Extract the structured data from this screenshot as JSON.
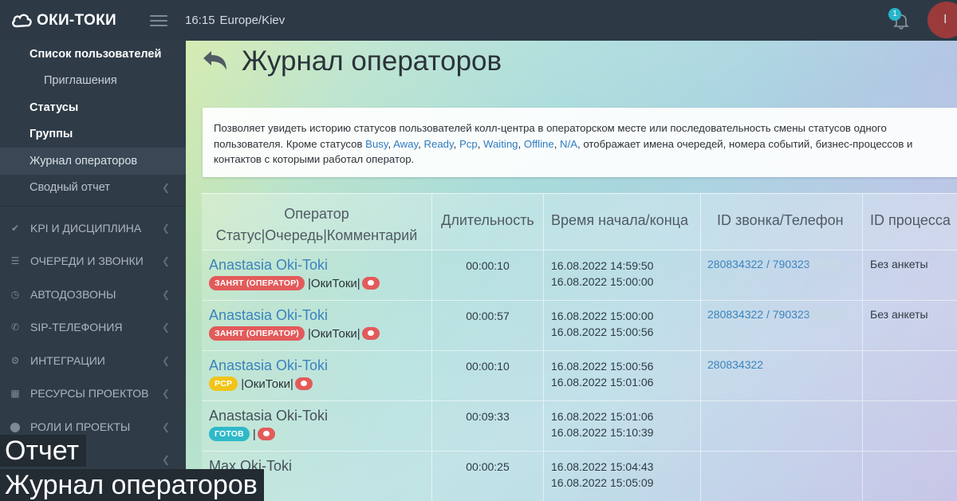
{
  "app": {
    "logo_text": "ОКИ-ТОКИ",
    "time": "16:15",
    "timezone": "Europe/Kiev",
    "notifications": "1",
    "avatar_letter": "I"
  },
  "sidebar": {
    "items": [
      {
        "label": "Список пользователей"
      },
      {
        "label": "Приглашения"
      },
      {
        "label": "Статусы"
      },
      {
        "label": "Группы"
      },
      {
        "label": "Журнал операторов"
      },
      {
        "label": "Сводный отчет"
      }
    ],
    "groups": [
      {
        "label": "KPI И ДИСЦИПЛИНА",
        "icon": "check-icon"
      },
      {
        "label": "ОЧЕРЕДИ И ЗВОНКИ",
        "icon": "list-icon"
      },
      {
        "label": "АВТОДОЗВОНЫ",
        "icon": "clock-icon"
      },
      {
        "label": "SIP-ТЕЛЕФОНИЯ",
        "icon": "phone-icon"
      },
      {
        "label": "ИНТЕГРАЦИИ",
        "icon": "gears-icon"
      },
      {
        "label": "РЕСУРСЫ ПРОЕКТОВ",
        "icon": "grid-icon"
      },
      {
        "label": "РОЛИ И ПРОЕКТЫ",
        "icon": "toggle-icon"
      }
    ]
  },
  "page": {
    "title": "Журнал операторов",
    "description": {
      "text_before": "Позволяет увидеть историю статусов пользователей колл-центра в операторском месте или последовательность смены статусов одного пользователя. Кроме статусов ",
      "statuses": [
        "Busy",
        "Away",
        "Ready",
        "Pcp",
        "Waiting",
        "Offline",
        "N/A"
      ],
      "text_after": ", отображает имена очередей, номера событий, бизнес-процессов и контактов с которыми работал оператор."
    }
  },
  "table": {
    "headers": {
      "operator_line1": "Оператор",
      "operator_line2": "Статус|Очередь|Комментарий",
      "duration": "Длительность",
      "time": "Время начала/конца",
      "call": "ID звонка/Телефон",
      "process": "ID процесса"
    },
    "rows": [
      {
        "operator": "Anastasia Oki-Toki",
        "status": "ЗАНЯТ (ОПЕРАТОР)",
        "queue": "|ОкиТоки|",
        "duration": "00:00:10",
        "start": "16.08.2022 14:59:50",
        "end": "16.08.2022 15:00:00",
        "call": "280834322 / 790323",
        "process": "Без анкеты"
      },
      {
        "operator": "Anastasia Oki-Toki",
        "status": "ЗАНЯТ (ОПЕРАТОР)",
        "queue": "|ОкиТоки|",
        "duration": "00:00:57",
        "start": "16.08.2022 15:00:00",
        "end": "16.08.2022 15:00:56",
        "call": "280834322 / 790323",
        "process": "Без анкеты"
      },
      {
        "operator": "Anastasia Oki-Toki",
        "status": "PCP",
        "queue": "|ОкиТоки|",
        "duration": "00:00:10",
        "start": "16.08.2022 15:00:56",
        "end": "16.08.2022 15:01:06",
        "call": "280834322",
        "process": ""
      },
      {
        "operator": "Anastasia Oki-Toki",
        "status": "ГОТОВ",
        "queue": "|",
        "duration": "00:09:33",
        "start": "16.08.2022 15:01:06",
        "end": "16.08.2022 15:10:39",
        "call": "",
        "process": ""
      },
      {
        "operator": "Max Oki-Toki",
        "status": "",
        "queue": "",
        "duration": "00:00:25",
        "start": "16.08.2022 15:04:43",
        "end": "16.08.2022 15:05:09",
        "call": "",
        "process": ""
      }
    ]
  },
  "captions": {
    "line1": "Отчет",
    "line2": "Журнал операторов"
  },
  "colors": {
    "sidebar": "#2f3c48",
    "link": "#3b83bd",
    "badge_busy": "#e35a5a",
    "badge_pcp": "#f0c419",
    "badge_ready": "#2fb9c9"
  }
}
